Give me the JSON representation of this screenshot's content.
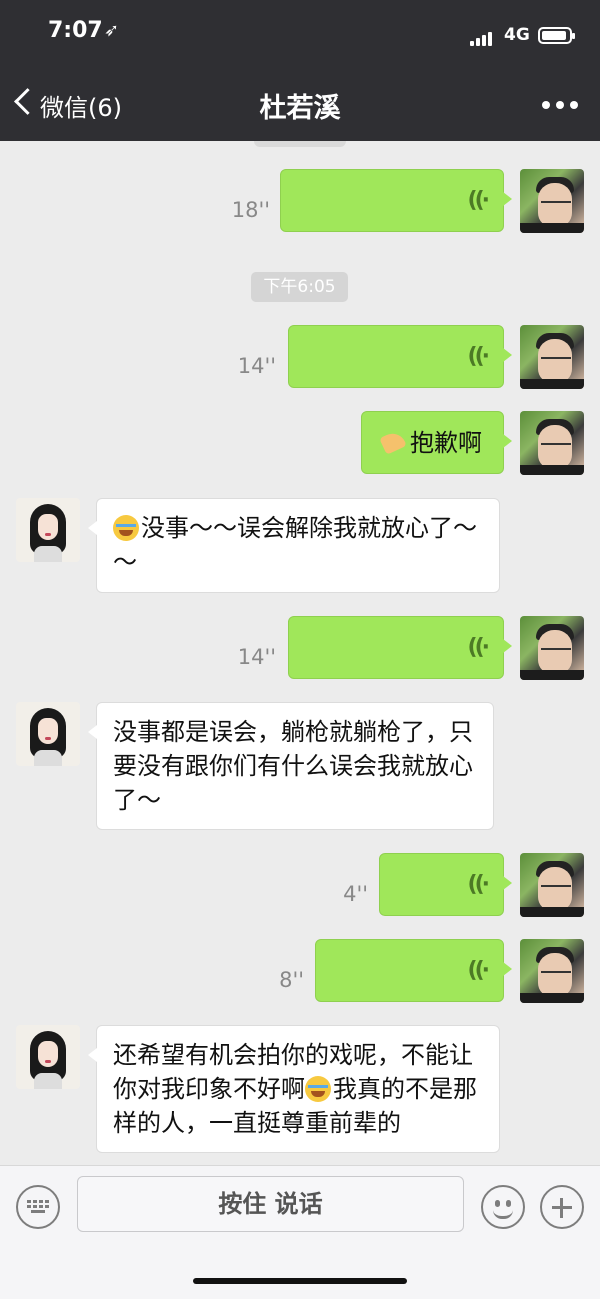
{
  "status_bar": {
    "time": "7:07",
    "location_arrow": "➶",
    "network": "4G",
    "icons": [
      "signal-icon",
      "battery-icon"
    ]
  },
  "nav": {
    "back_label": "微信(6)",
    "title": "杜若溪",
    "more_icon": "more-icon"
  },
  "chat": {
    "timestamp": "下午6:05",
    "voice_icon": "((·",
    "messages": [
      {
        "from": "me",
        "type": "voice",
        "duration": "18''"
      },
      {
        "from": "me",
        "type": "voice",
        "duration": "14''"
      },
      {
        "from": "me",
        "type": "text",
        "text": "抱歉啊",
        "emoji": "folded-hands"
      },
      {
        "from": "her",
        "type": "text",
        "text": "没事～～误会解除我就放心了～～",
        "emoji": "laughing-tears"
      },
      {
        "from": "me",
        "type": "voice",
        "duration": "14''"
      },
      {
        "from": "her",
        "type": "text",
        "text": "没事都是误会，躺枪就躺枪了，只要没有跟你们有什么误会我就放心了～"
      },
      {
        "from": "me",
        "type": "voice",
        "duration": "4''"
      },
      {
        "from": "me",
        "type": "voice",
        "duration": "8''"
      },
      {
        "from": "her",
        "type": "text",
        "text_before": "还希望有机会拍你的戏呢，不能让你对我印象不好啊",
        "text_after": "我真的不是那样的人，一直挺尊重前辈的",
        "emoji": "laughing-tears"
      }
    ]
  },
  "input_bar": {
    "hold_to_talk": "按住 说话",
    "icons": [
      "keyboard-icon",
      "emoji-icon",
      "plus-icon"
    ]
  },
  "colors": {
    "header": "#2f2f33",
    "chat_bg": "#ececec",
    "my_bubble": "#a0e75a",
    "their_bubble": "#ffffff"
  }
}
